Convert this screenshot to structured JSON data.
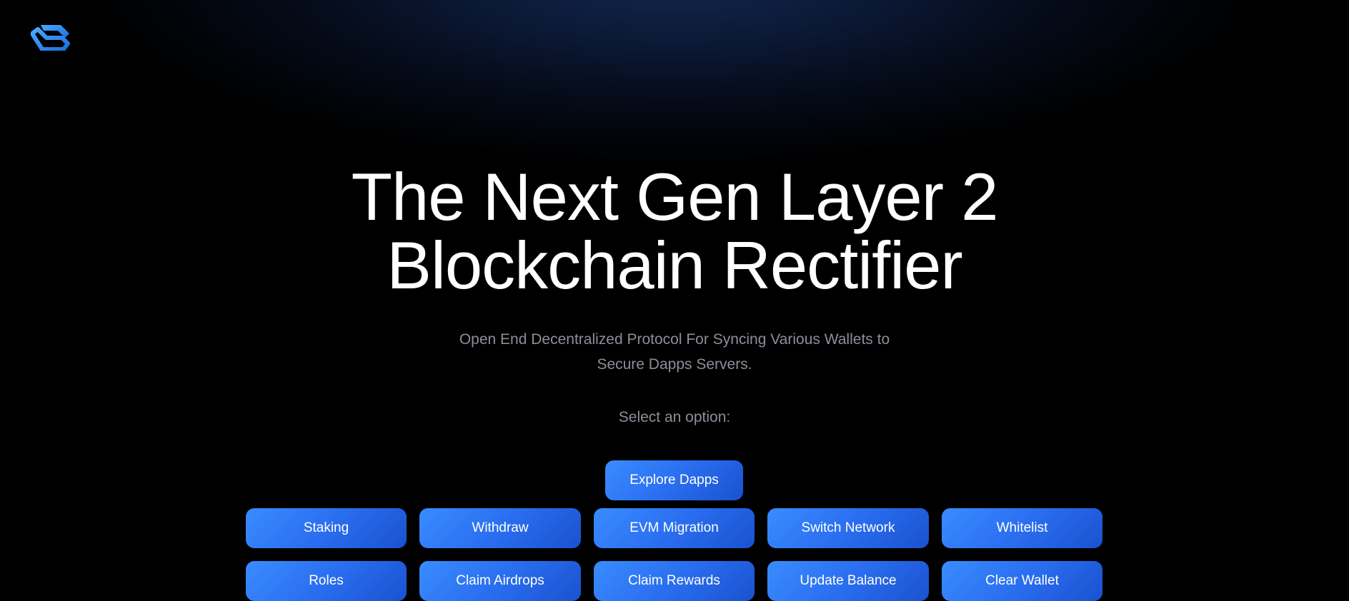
{
  "brand": {
    "logo_icon": "layered-chevron-logo-icon",
    "accent_light": "#3a8cff",
    "accent_dark": "#1a52cf"
  },
  "hero": {
    "title_line1": "The Next Gen Layer 2",
    "title_line2": "Blockchain Rectifier",
    "subtitle_line1": "Open End Decentralized Protocol For Syncing Various Wallets to",
    "subtitle_line2": "Secure Dapps Servers.",
    "select_label": "Select an option:"
  },
  "primary_action": {
    "label": "Explore Dapps"
  },
  "options_row1": [
    {
      "label": "Staking"
    },
    {
      "label": "Withdraw"
    },
    {
      "label": "EVM Migration"
    },
    {
      "label": "Switch Network"
    },
    {
      "label": "Whitelist"
    }
  ],
  "options_row2": [
    {
      "label": "Roles"
    },
    {
      "label": "Claim Airdrops"
    },
    {
      "label": "Claim Rewards"
    },
    {
      "label": "Update Balance"
    },
    {
      "label": "Clear Wallet"
    }
  ]
}
